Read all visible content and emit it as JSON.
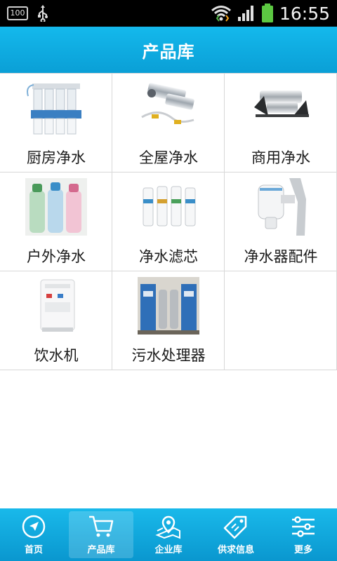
{
  "status_bar": {
    "battery_percent": "100",
    "time": "16:55",
    "icons": [
      "battery-level-icon",
      "usb-icon",
      "wifi-icon",
      "signal-icon",
      "battery-icon"
    ]
  },
  "header": {
    "title": "产品库"
  },
  "categories": [
    {
      "label": "厨房净水",
      "icon": "ro-filter-system-image"
    },
    {
      "label": "全屋净水",
      "icon": "whole-house-filter-image"
    },
    {
      "label": "商用净水",
      "icon": "commercial-filter-image"
    },
    {
      "label": "户外净水",
      "icon": "water-bottles-image"
    },
    {
      "label": "净水滤芯",
      "icon": "filter-cartridges-image"
    },
    {
      "label": "净水器配件",
      "icon": "faucet-filter-image"
    },
    {
      "label": "饮水机",
      "icon": "water-dispenser-image"
    },
    {
      "label": "污水处理器",
      "icon": "sewage-treatment-image"
    }
  ],
  "bottom_nav": {
    "active": "产品库",
    "items": [
      {
        "label": "首页",
        "icon": "compass-icon"
      },
      {
        "label": "产品库",
        "icon": "cart-icon"
      },
      {
        "label": "企业库",
        "icon": "map-icon"
      },
      {
        "label": "供求信息",
        "icon": "tag-icon"
      },
      {
        "label": "更多",
        "icon": "sliders-icon"
      }
    ]
  },
  "colors": {
    "accent": "#0fa9e0",
    "text": "#1a1a1a",
    "divider": "#d8d8d8"
  }
}
